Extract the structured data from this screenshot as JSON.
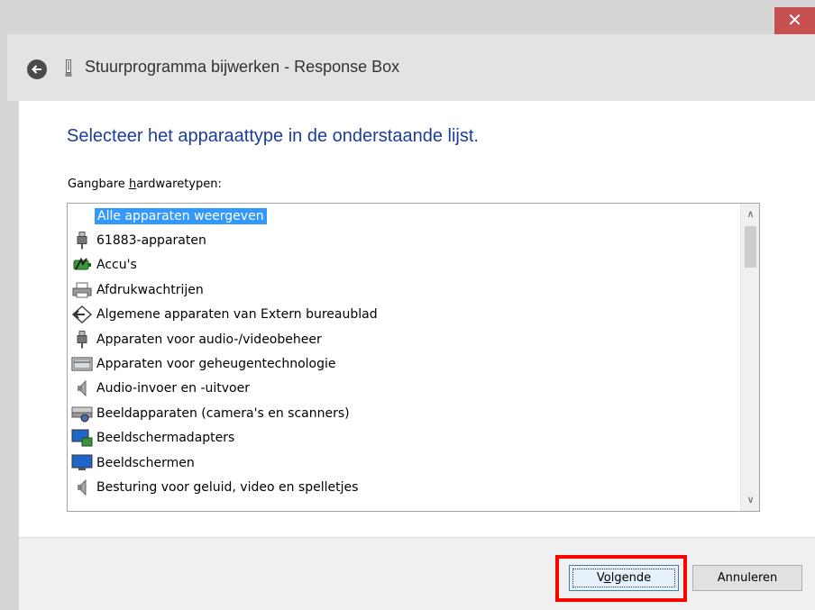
{
  "window": {
    "close_glyph": "✕",
    "title": "Stuurprogramma bijwerken - Response Box",
    "back_glyph": "🡐"
  },
  "content": {
    "instruction": "Selecteer het apparaattype in de onderstaande lijst.",
    "list_label_pre": "Gangbare ",
    "list_label_u": "h",
    "list_label_post": "ardwaretypen:"
  },
  "list": {
    "selected_item": "Alle apparaten weergeven",
    "items": [
      {
        "label": "61883-apparaten",
        "icon": "usb-plug-icon"
      },
      {
        "label": "Accu's",
        "icon": "battery-icon"
      },
      {
        "label": "Afdrukwachtrijen",
        "icon": "printer-icon"
      },
      {
        "label": "Algemene apparaten van Extern bureaublad",
        "icon": "remote-desktop-icon"
      },
      {
        "label": "Apparaten voor audio-/videobeheer",
        "icon": "usb-plug-icon"
      },
      {
        "label": "Apparaten voor geheugentechnologie",
        "icon": "memory-card-icon"
      },
      {
        "label": "Audio-invoer en -uitvoer",
        "icon": "speaker-icon"
      },
      {
        "label": "Beeldapparaten (camera's en scanners)",
        "icon": "camera-scanner-icon"
      },
      {
        "label": "Beeldschermadapters",
        "icon": "display-adapter-icon"
      },
      {
        "label": "Beeldschermen",
        "icon": "monitor-icon"
      },
      {
        "label": "Besturing voor geluid, video en spelletjes",
        "icon": "speaker-icon"
      }
    ],
    "scroll_up_glyph": "∧",
    "scroll_down_glyph": "∨"
  },
  "footer": {
    "next_pre": "V",
    "next_u": "o",
    "next_post": "lgende",
    "cancel_label": "Annuleren"
  },
  "colors": {
    "instruction_blue": "#1c3e99",
    "selection_blue": "#3399ff",
    "close_red": "#c75050",
    "highlight_red": "#ff0000"
  }
}
